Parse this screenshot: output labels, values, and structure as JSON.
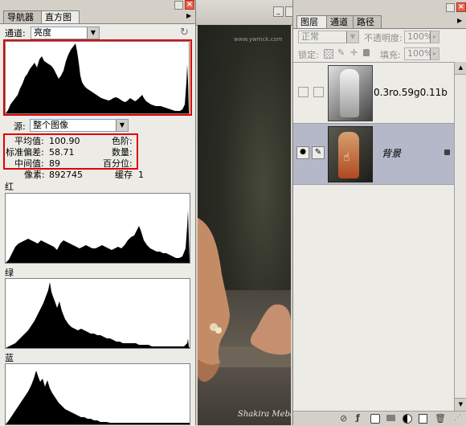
{
  "histogram_panel": {
    "tabs": [
      {
        "label": "导航器"
      },
      {
        "label": "直方图"
      }
    ],
    "channel_label": "通道:",
    "channel_value": "亮度",
    "source_label": "源:",
    "source_value": "整个图像",
    "stats": {
      "mean_label": "平均值:",
      "mean_value": "100.90",
      "stddev_label": "标准偏差:",
      "stddev_value": "58.71",
      "median_label": "中间值:",
      "median_value": "89",
      "pixels_label": "像素:",
      "pixels_value": "892745",
      "level_label": "色阶:",
      "count_label": "数量:",
      "percentile_label": "百分位:",
      "cache_label": "缓存",
      "cache_value": "1"
    },
    "red_label": "红",
    "green_label": "绿",
    "blue_label": "蓝"
  },
  "canvas": {
    "watermark_top": "www.ywmck.com",
    "caption": "Shakira Mebar"
  },
  "layers_panel": {
    "tabs": [
      {
        "label": "图层"
      },
      {
        "label": "通道"
      },
      {
        "label": "路径"
      }
    ],
    "blend_mode": "正常",
    "opacity_label": "不透明度:",
    "opacity_value": "100%",
    "lock_label": "锁定:",
    "fill_label": "填充:",
    "fill_value": "100%",
    "layers": [
      {
        "name": "0.3ro.59g0.11b",
        "visible": false,
        "selected": false
      },
      {
        "name": "背景",
        "visible": true,
        "selected": true
      }
    ]
  },
  "colors": {
    "panel_bg": "#d4d0c8",
    "selected_layer": "#b4b8c8",
    "highlight_red": "#e00000",
    "close_red": "#e8604a"
  }
}
